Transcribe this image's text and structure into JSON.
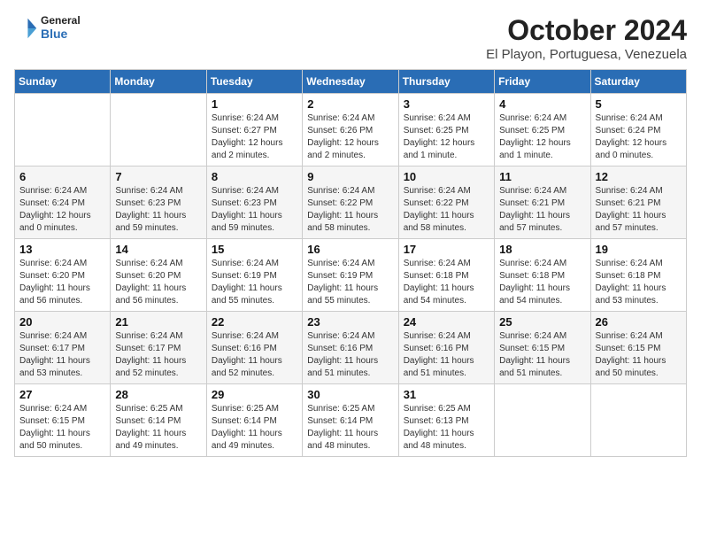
{
  "header": {
    "logo_general": "General",
    "logo_blue": "Blue",
    "title": "October 2024",
    "subtitle": "El Playon, Portuguesa, Venezuela"
  },
  "days_of_week": [
    "Sunday",
    "Monday",
    "Tuesday",
    "Wednesday",
    "Thursday",
    "Friday",
    "Saturday"
  ],
  "weeks": [
    [
      {
        "day": "",
        "sunrise": "",
        "sunset": "",
        "daylight": ""
      },
      {
        "day": "",
        "sunrise": "",
        "sunset": "",
        "daylight": ""
      },
      {
        "day": "1",
        "sunrise": "Sunrise: 6:24 AM",
        "sunset": "Sunset: 6:27 PM",
        "daylight": "Daylight: 12 hours and 2 minutes."
      },
      {
        "day": "2",
        "sunrise": "Sunrise: 6:24 AM",
        "sunset": "Sunset: 6:26 PM",
        "daylight": "Daylight: 12 hours and 2 minutes."
      },
      {
        "day": "3",
        "sunrise": "Sunrise: 6:24 AM",
        "sunset": "Sunset: 6:25 PM",
        "daylight": "Daylight: 12 hours and 1 minute."
      },
      {
        "day": "4",
        "sunrise": "Sunrise: 6:24 AM",
        "sunset": "Sunset: 6:25 PM",
        "daylight": "Daylight: 12 hours and 1 minute."
      },
      {
        "day": "5",
        "sunrise": "Sunrise: 6:24 AM",
        "sunset": "Sunset: 6:24 PM",
        "daylight": "Daylight: 12 hours and 0 minutes."
      }
    ],
    [
      {
        "day": "6",
        "sunrise": "Sunrise: 6:24 AM",
        "sunset": "Sunset: 6:24 PM",
        "daylight": "Daylight: 12 hours and 0 minutes."
      },
      {
        "day": "7",
        "sunrise": "Sunrise: 6:24 AM",
        "sunset": "Sunset: 6:23 PM",
        "daylight": "Daylight: 11 hours and 59 minutes."
      },
      {
        "day": "8",
        "sunrise": "Sunrise: 6:24 AM",
        "sunset": "Sunset: 6:23 PM",
        "daylight": "Daylight: 11 hours and 59 minutes."
      },
      {
        "day": "9",
        "sunrise": "Sunrise: 6:24 AM",
        "sunset": "Sunset: 6:22 PM",
        "daylight": "Daylight: 11 hours and 58 minutes."
      },
      {
        "day": "10",
        "sunrise": "Sunrise: 6:24 AM",
        "sunset": "Sunset: 6:22 PM",
        "daylight": "Daylight: 11 hours and 58 minutes."
      },
      {
        "day": "11",
        "sunrise": "Sunrise: 6:24 AM",
        "sunset": "Sunset: 6:21 PM",
        "daylight": "Daylight: 11 hours and 57 minutes."
      },
      {
        "day": "12",
        "sunrise": "Sunrise: 6:24 AM",
        "sunset": "Sunset: 6:21 PM",
        "daylight": "Daylight: 11 hours and 57 minutes."
      }
    ],
    [
      {
        "day": "13",
        "sunrise": "Sunrise: 6:24 AM",
        "sunset": "Sunset: 6:20 PM",
        "daylight": "Daylight: 11 hours and 56 minutes."
      },
      {
        "day": "14",
        "sunrise": "Sunrise: 6:24 AM",
        "sunset": "Sunset: 6:20 PM",
        "daylight": "Daylight: 11 hours and 56 minutes."
      },
      {
        "day": "15",
        "sunrise": "Sunrise: 6:24 AM",
        "sunset": "Sunset: 6:19 PM",
        "daylight": "Daylight: 11 hours and 55 minutes."
      },
      {
        "day": "16",
        "sunrise": "Sunrise: 6:24 AM",
        "sunset": "Sunset: 6:19 PM",
        "daylight": "Daylight: 11 hours and 55 minutes."
      },
      {
        "day": "17",
        "sunrise": "Sunrise: 6:24 AM",
        "sunset": "Sunset: 6:18 PM",
        "daylight": "Daylight: 11 hours and 54 minutes."
      },
      {
        "day": "18",
        "sunrise": "Sunrise: 6:24 AM",
        "sunset": "Sunset: 6:18 PM",
        "daylight": "Daylight: 11 hours and 54 minutes."
      },
      {
        "day": "19",
        "sunrise": "Sunrise: 6:24 AM",
        "sunset": "Sunset: 6:18 PM",
        "daylight": "Daylight: 11 hours and 53 minutes."
      }
    ],
    [
      {
        "day": "20",
        "sunrise": "Sunrise: 6:24 AM",
        "sunset": "Sunset: 6:17 PM",
        "daylight": "Daylight: 11 hours and 53 minutes."
      },
      {
        "day": "21",
        "sunrise": "Sunrise: 6:24 AM",
        "sunset": "Sunset: 6:17 PM",
        "daylight": "Daylight: 11 hours and 52 minutes."
      },
      {
        "day": "22",
        "sunrise": "Sunrise: 6:24 AM",
        "sunset": "Sunset: 6:16 PM",
        "daylight": "Daylight: 11 hours and 52 minutes."
      },
      {
        "day": "23",
        "sunrise": "Sunrise: 6:24 AM",
        "sunset": "Sunset: 6:16 PM",
        "daylight": "Daylight: 11 hours and 51 minutes."
      },
      {
        "day": "24",
        "sunrise": "Sunrise: 6:24 AM",
        "sunset": "Sunset: 6:16 PM",
        "daylight": "Daylight: 11 hours and 51 minutes."
      },
      {
        "day": "25",
        "sunrise": "Sunrise: 6:24 AM",
        "sunset": "Sunset: 6:15 PM",
        "daylight": "Daylight: 11 hours and 51 minutes."
      },
      {
        "day": "26",
        "sunrise": "Sunrise: 6:24 AM",
        "sunset": "Sunset: 6:15 PM",
        "daylight": "Daylight: 11 hours and 50 minutes."
      }
    ],
    [
      {
        "day": "27",
        "sunrise": "Sunrise: 6:24 AM",
        "sunset": "Sunset: 6:15 PM",
        "daylight": "Daylight: 11 hours and 50 minutes."
      },
      {
        "day": "28",
        "sunrise": "Sunrise: 6:25 AM",
        "sunset": "Sunset: 6:14 PM",
        "daylight": "Daylight: 11 hours and 49 minutes."
      },
      {
        "day": "29",
        "sunrise": "Sunrise: 6:25 AM",
        "sunset": "Sunset: 6:14 PM",
        "daylight": "Daylight: 11 hours and 49 minutes."
      },
      {
        "day": "30",
        "sunrise": "Sunrise: 6:25 AM",
        "sunset": "Sunset: 6:14 PM",
        "daylight": "Daylight: 11 hours and 48 minutes."
      },
      {
        "day": "31",
        "sunrise": "Sunrise: 6:25 AM",
        "sunset": "Sunset: 6:13 PM",
        "daylight": "Daylight: 11 hours and 48 minutes."
      },
      {
        "day": "",
        "sunrise": "",
        "sunset": "",
        "daylight": ""
      },
      {
        "day": "",
        "sunrise": "",
        "sunset": "",
        "daylight": ""
      }
    ]
  ]
}
